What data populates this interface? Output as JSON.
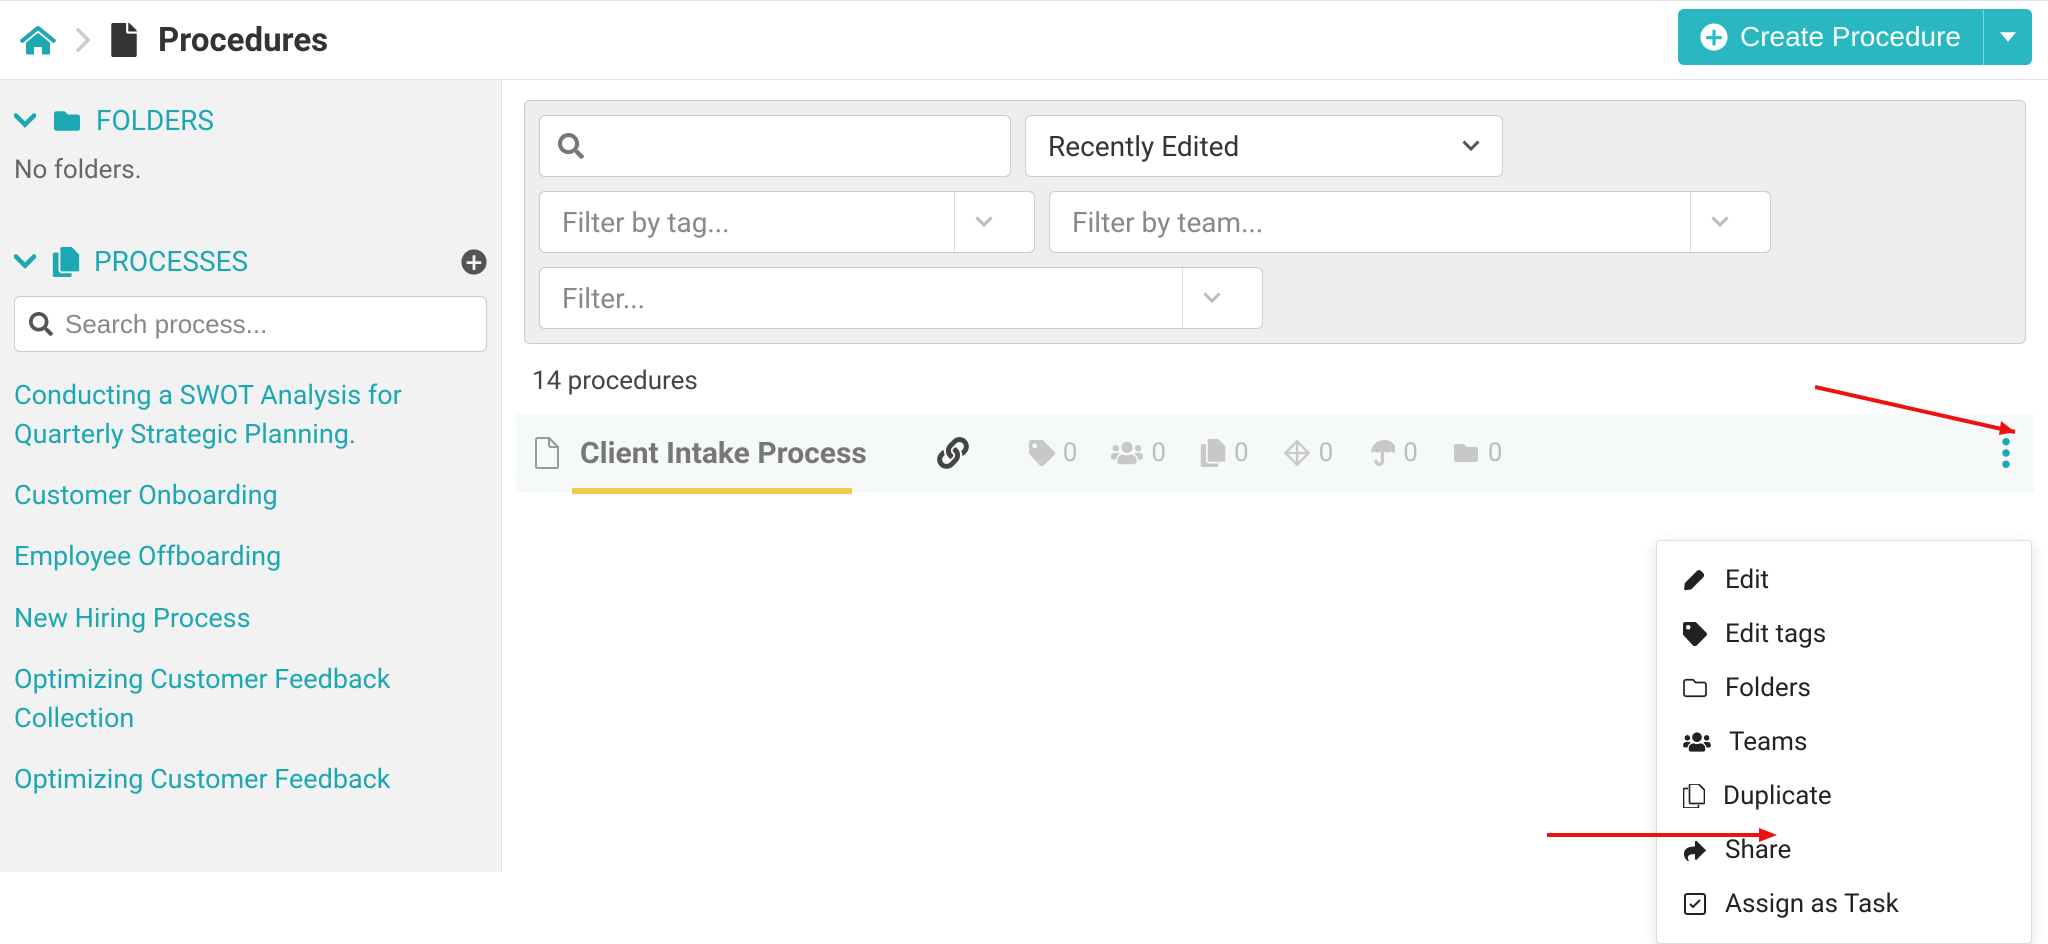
{
  "header": {
    "page_title": "Procedures",
    "create_label": "Create Procedure"
  },
  "sidebar": {
    "folders_heading": "FOLDERS",
    "no_folders": "No folders.",
    "processes_heading": "PROCESSES",
    "search_placeholder": "Search process...",
    "process_links": [
      "Conducting a SWOT Analysis for Quarterly Strategic Planning.",
      "Customer Onboarding",
      "Employee Offboarding",
      "New Hiring Process",
      "Optimizing Customer Feedback Collection",
      "Optimizing Customer Feedback"
    ]
  },
  "filters": {
    "sort_label": "Recently Edited",
    "tag_placeholder": "Filter by tag...",
    "team_placeholder": "Filter by team...",
    "filter_placeholder": "Filter..."
  },
  "count_label": "14 procedures",
  "procedure_row": {
    "title": "Client Intake Process",
    "stats": {
      "tags": "0",
      "teams": "0",
      "copies": "0",
      "diamond": "0",
      "umbrella": "0",
      "folder": "0"
    }
  },
  "menu": {
    "edit": "Edit",
    "edit_tags": "Edit tags",
    "folders": "Folders",
    "teams": "Teams",
    "duplicate": "Duplicate",
    "share": "Share",
    "assign": "Assign as Task"
  }
}
